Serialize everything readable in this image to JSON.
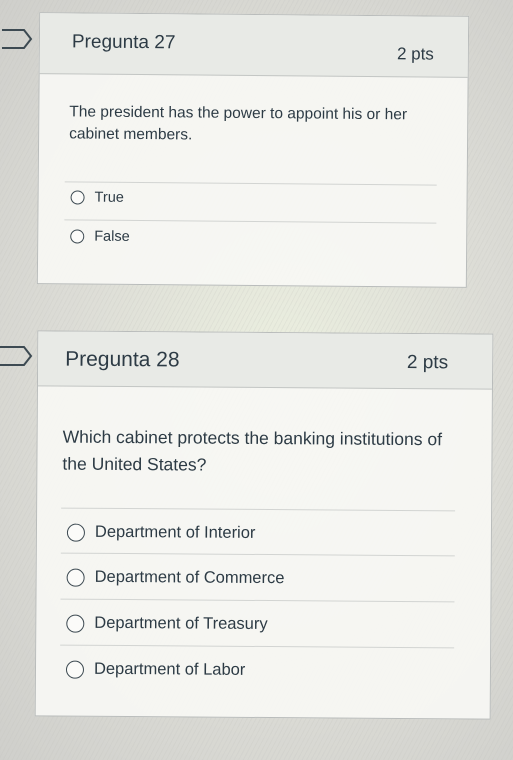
{
  "questions": [
    {
      "title": "Pregunta 27",
      "points": "2 pts",
      "text": "The president has the power to appoint his or her cabinet members.",
      "answers": [
        "True",
        "False"
      ]
    },
    {
      "title": "Pregunta 28",
      "points": "2 pts",
      "text": "Which cabinet protects the banking institutions of the United States?",
      "answers": [
        "Department of Interior",
        "Department of Commerce",
        "Department of Treasury",
        "Department of Labor"
      ]
    }
  ],
  "icons": {
    "flag": "bookmark-flag-icon"
  },
  "colors": {
    "text": "#2d3b45",
    "header_bg": "#e7e9e5",
    "card_bg": "#f7f7f4"
  }
}
